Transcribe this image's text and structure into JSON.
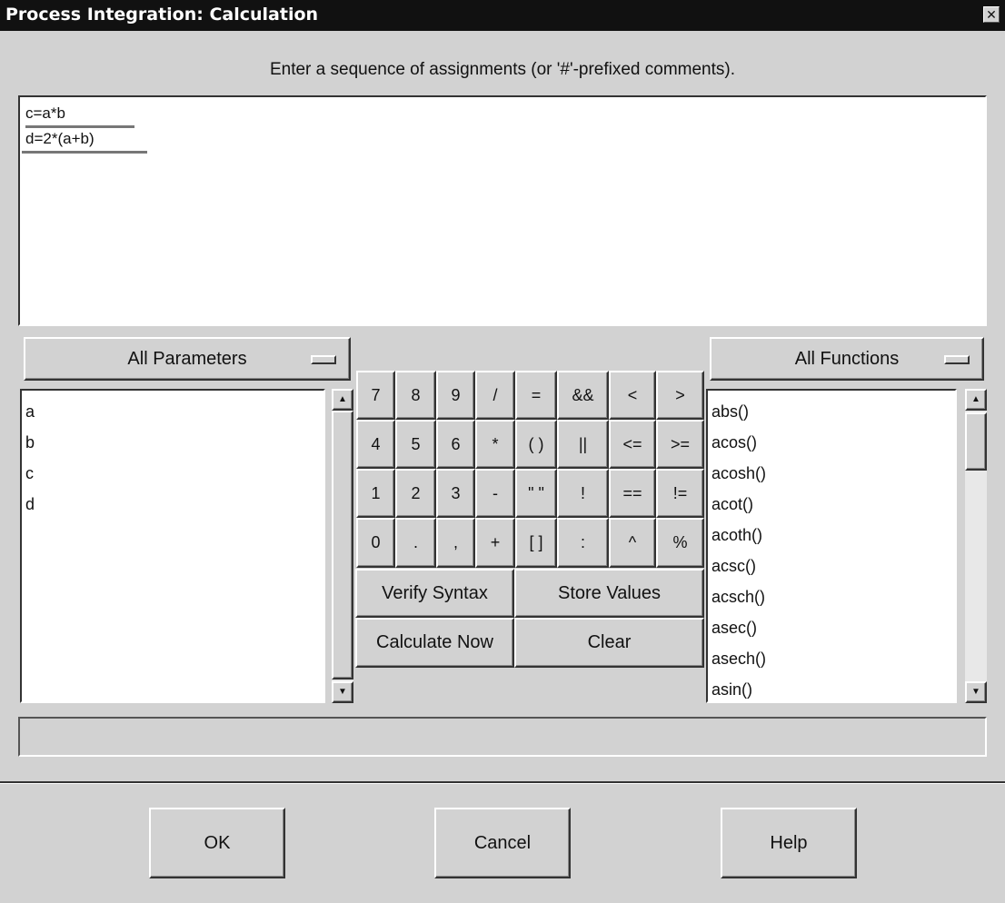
{
  "window": {
    "title": "Process Integration:  Calculation",
    "close_icon": "close-icon"
  },
  "prompt": "Enter a sequence of assignments (or '#'-prefixed comments).",
  "editor": {
    "lines": [
      "c=a*b",
      "d=2*(a+b)"
    ]
  },
  "parameters": {
    "dropdown": "All Parameters",
    "items": [
      "a",
      "b",
      "c",
      "d"
    ]
  },
  "functions": {
    "dropdown": "All Functions",
    "items": [
      "abs()",
      "acos()",
      "acosh()",
      "acot()",
      "acoth()",
      "acsc()",
      "acsch()",
      "asec()",
      "asech()",
      "asin()"
    ]
  },
  "keypad": [
    [
      "7",
      "8",
      "9",
      "/",
      "=",
      "&&",
      "<",
      ">"
    ],
    [
      "4",
      "5",
      "6",
      "*",
      "( )",
      "||",
      "<=",
      ">="
    ],
    [
      "1",
      "2",
      "3",
      "-",
      "\" \"",
      "!",
      "==",
      "!="
    ],
    [
      "0",
      ".",
      ",",
      "+",
      "[ ]",
      ":",
      "^",
      "%"
    ]
  ],
  "actions": {
    "verify": "Verify Syntax",
    "store": "Store Values",
    "calculate": "Calculate Now",
    "clear": "Clear"
  },
  "status": "",
  "footer": {
    "ok": "OK",
    "cancel": "Cancel",
    "help": "Help"
  }
}
